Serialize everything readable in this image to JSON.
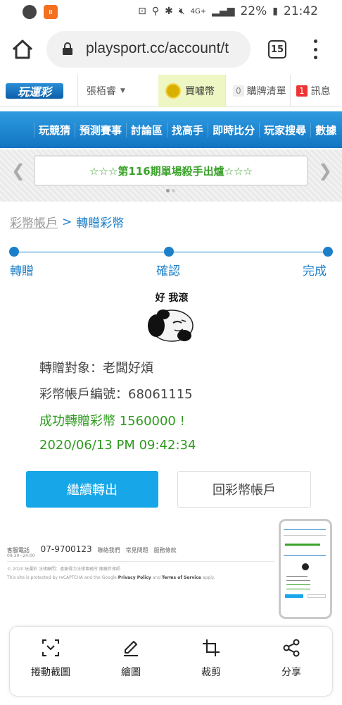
{
  "statusbar": {
    "battery_percent": "22%",
    "time": "21:42",
    "network": "4G+",
    "app2_label": "B"
  },
  "browser": {
    "url": "playsport.cc/account/t",
    "tab_count": "15"
  },
  "site_header": {
    "logo_text": "玩運彩",
    "username": "張栢睿",
    "buy_coin_label": "買噱幣",
    "cart_count": "0",
    "cart_label": "購牌清單",
    "msg_count": "1",
    "msg_label": "訊息"
  },
  "nav": {
    "items": [
      "玩競猜",
      "預測賽事",
      "討論區",
      "找高手",
      "即時比分",
      "玩家搜尋",
      "數據"
    ]
  },
  "banner": {
    "text": "☆☆☆第116期單場殺手出爐☆☆☆"
  },
  "breadcrumb": {
    "parent": "彩幣帳戶",
    "separator": ">",
    "current": "轉贈彩幣"
  },
  "steps": [
    "轉贈",
    "確認",
    "完成"
  ],
  "meme": {
    "caption": "好 我滾"
  },
  "result": {
    "recipient": "轉贈對象：老闆好煩",
    "account": "彩幣帳戶編號：68061115",
    "success": "成功轉贈彩幣 1560000 !",
    "timestamp": "2020/06/13 PM 09:42:34"
  },
  "buttons": {
    "continue": "繼續轉出",
    "back": "回彩幣帳戶"
  },
  "footer": {
    "service_label": "客服電話",
    "service_hours": "09:30~24:00",
    "phone": "07-9700123",
    "links": [
      "聯絡我們",
      "常見問題",
      "服務條款"
    ],
    "copyright": "© 2020 玩運彩 法律顧問：遠東得力法律事務所 陳鏡世律師",
    "recaptcha_prefix": "This site is protected by reCAPTCHA and the Google",
    "privacy": "Privacy Policy",
    "and": "and",
    "terms": "Terms of Service",
    "apply": "apply."
  },
  "actionbar": {
    "items": [
      "捲動截圖",
      "繪圖",
      "裁剪",
      "分享"
    ]
  },
  "colors": {
    "brand_blue": "#1c7fc9",
    "success_green": "#2e9a1e",
    "primary_button": "#17a7e8"
  }
}
